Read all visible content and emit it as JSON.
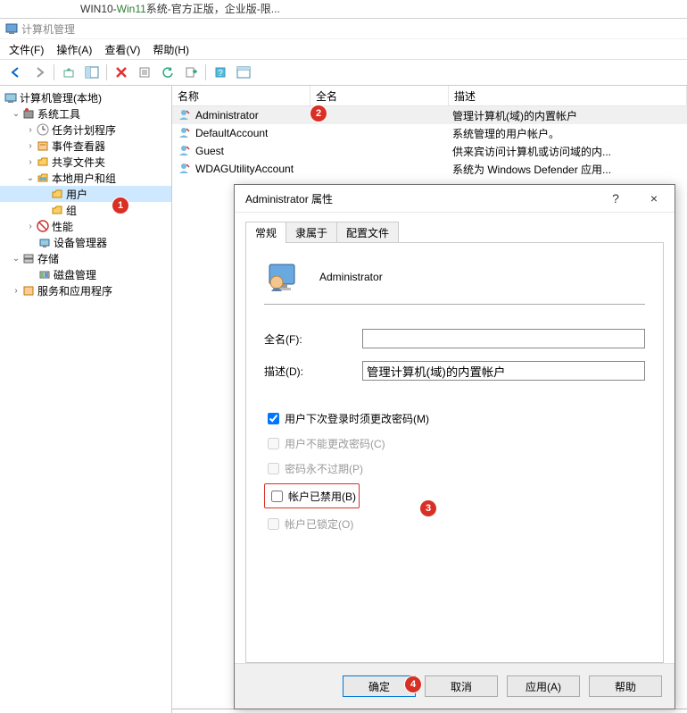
{
  "topstrip": {
    "left": "WIN10-",
    "green": "Win11",
    "rest": "系统-官方正版，企业版-限..."
  },
  "window": {
    "title": "计算机管理"
  },
  "menu": {
    "file": "文件(F)",
    "action": "操作(A)",
    "view": "查看(V)",
    "help": "帮助(H)"
  },
  "tree": {
    "root": "计算机管理(本地)",
    "system_tools": "系统工具",
    "task_scheduler": "任务计划程序",
    "event_viewer": "事件查看器",
    "shared_folders": "共享文件夹",
    "local_users": "本地用户和组",
    "users": "用户",
    "groups": "组",
    "performance": "性能",
    "device_manager": "设备管理器",
    "storage": "存储",
    "disk_mgmt": "磁盘管理",
    "services_apps": "服务和应用程序"
  },
  "list": {
    "col_name": "名称",
    "col_full": "全名",
    "col_desc": "描述",
    "rows": [
      {
        "name": "Administrator",
        "desc": "管理计算机(域)的内置帐户"
      },
      {
        "name": "DefaultAccount",
        "desc": "系统管理的用户帐户。"
      },
      {
        "name": "Guest",
        "desc": "供来宾访问计算机或访问域的内..."
      },
      {
        "name": "WDAGUtilityAccount",
        "desc": "系统为 Windows Defender 应用..."
      }
    ]
  },
  "dialog": {
    "title": "Administrator 属性",
    "help": "?",
    "close": "×",
    "tab_general": "常规",
    "tab_member": "隶属于",
    "tab_profile": "配置文件",
    "prop_name": "Administrator",
    "lab_full": "全名(F):",
    "lab_desc": "描述(D):",
    "val_full": "",
    "val_desc": "管理计算机(域)的内置帐户",
    "chk1": "用户下次登录时须更改密码(M)",
    "chk2": "用户不能更改密码(C)",
    "chk3": "密码永不过期(P)",
    "chk4": "帐户已禁用(B)",
    "chk5": "帐户已锁定(O)",
    "ok": "确定",
    "cancel": "取消",
    "apply": "应用(A)",
    "help_btn": "帮助"
  },
  "badges": {
    "b1": "1",
    "b2": "2",
    "b3": "3",
    "b4": "4"
  }
}
